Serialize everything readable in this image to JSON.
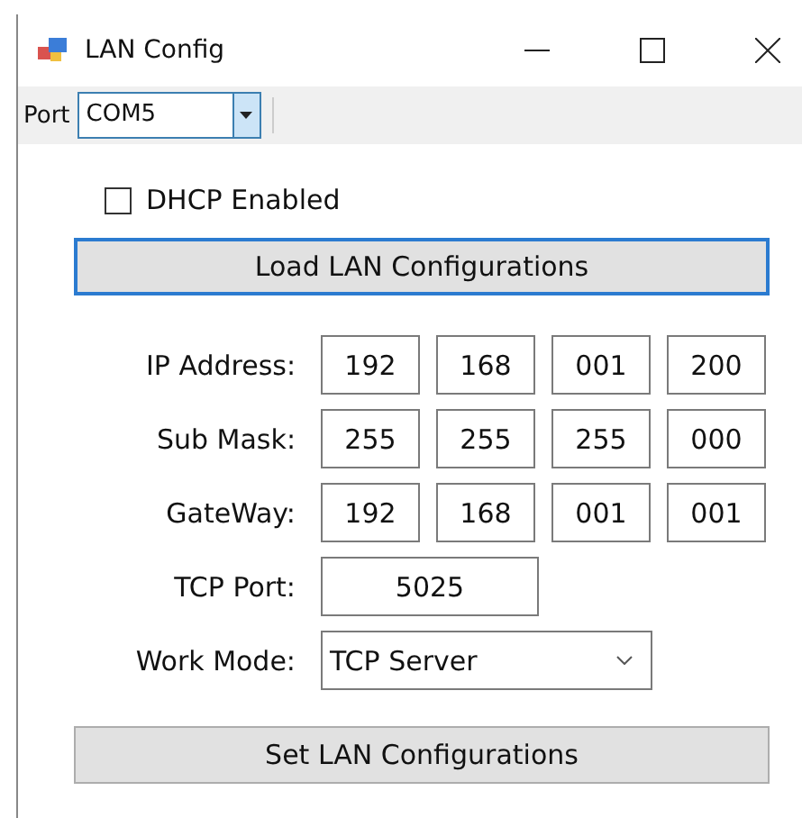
{
  "window": {
    "title": "LAN Config"
  },
  "toolbar": {
    "port_label": "Port",
    "port_value": "COM5"
  },
  "dhcp": {
    "label": "DHCP Enabled",
    "checked": false
  },
  "load_button": "Load LAN Configurations",
  "address_rows": [
    {
      "label": "IP Address:",
      "octets": [
        "192",
        "168",
        "001",
        "200"
      ]
    },
    {
      "label": "Sub Mask:",
      "octets": [
        "255",
        "255",
        "255",
        "000"
      ]
    },
    {
      "label": "GateWay:",
      "octets": [
        "192",
        "168",
        "001",
        "001"
      ]
    }
  ],
  "tcp_port": {
    "label": "TCP Port:",
    "value": "5025"
  },
  "work_mode": {
    "label": "Work Mode:",
    "value": "TCP Server"
  },
  "set_button": "Set LAN Configurations"
}
